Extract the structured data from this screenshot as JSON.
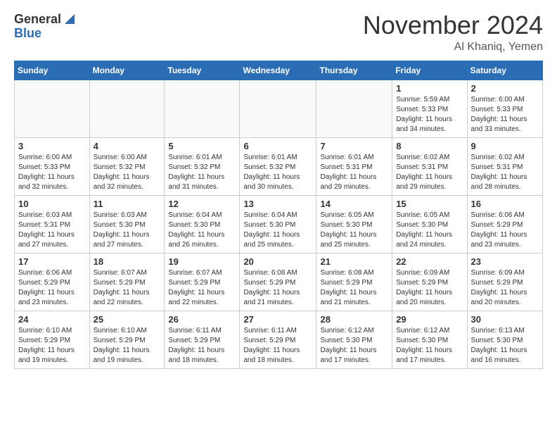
{
  "header": {
    "logo_general": "General",
    "logo_blue": "Blue",
    "title": "November 2024",
    "location": "Al Khaniq, Yemen"
  },
  "weekdays": [
    "Sunday",
    "Monday",
    "Tuesday",
    "Wednesday",
    "Thursday",
    "Friday",
    "Saturday"
  ],
  "weeks": [
    [
      {
        "day": "",
        "info": ""
      },
      {
        "day": "",
        "info": ""
      },
      {
        "day": "",
        "info": ""
      },
      {
        "day": "",
        "info": ""
      },
      {
        "day": "",
        "info": ""
      },
      {
        "day": "1",
        "info": "Sunrise: 5:59 AM\nSunset: 5:33 PM\nDaylight: 11 hours and 34 minutes."
      },
      {
        "day": "2",
        "info": "Sunrise: 6:00 AM\nSunset: 5:33 PM\nDaylight: 11 hours and 33 minutes."
      }
    ],
    [
      {
        "day": "3",
        "info": "Sunrise: 6:00 AM\nSunset: 5:33 PM\nDaylight: 11 hours and 32 minutes."
      },
      {
        "day": "4",
        "info": "Sunrise: 6:00 AM\nSunset: 5:32 PM\nDaylight: 11 hours and 32 minutes."
      },
      {
        "day": "5",
        "info": "Sunrise: 6:01 AM\nSunset: 5:32 PM\nDaylight: 11 hours and 31 minutes."
      },
      {
        "day": "6",
        "info": "Sunrise: 6:01 AM\nSunset: 5:32 PM\nDaylight: 11 hours and 30 minutes."
      },
      {
        "day": "7",
        "info": "Sunrise: 6:01 AM\nSunset: 5:31 PM\nDaylight: 11 hours and 29 minutes."
      },
      {
        "day": "8",
        "info": "Sunrise: 6:02 AM\nSunset: 5:31 PM\nDaylight: 11 hours and 29 minutes."
      },
      {
        "day": "9",
        "info": "Sunrise: 6:02 AM\nSunset: 5:31 PM\nDaylight: 11 hours and 28 minutes."
      }
    ],
    [
      {
        "day": "10",
        "info": "Sunrise: 6:03 AM\nSunset: 5:31 PM\nDaylight: 11 hours and 27 minutes."
      },
      {
        "day": "11",
        "info": "Sunrise: 6:03 AM\nSunset: 5:30 PM\nDaylight: 11 hours and 27 minutes."
      },
      {
        "day": "12",
        "info": "Sunrise: 6:04 AM\nSunset: 5:30 PM\nDaylight: 11 hours and 26 minutes."
      },
      {
        "day": "13",
        "info": "Sunrise: 6:04 AM\nSunset: 5:30 PM\nDaylight: 11 hours and 25 minutes."
      },
      {
        "day": "14",
        "info": "Sunrise: 6:05 AM\nSunset: 5:30 PM\nDaylight: 11 hours and 25 minutes."
      },
      {
        "day": "15",
        "info": "Sunrise: 6:05 AM\nSunset: 5:30 PM\nDaylight: 11 hours and 24 minutes."
      },
      {
        "day": "16",
        "info": "Sunrise: 6:06 AM\nSunset: 5:29 PM\nDaylight: 11 hours and 23 minutes."
      }
    ],
    [
      {
        "day": "17",
        "info": "Sunrise: 6:06 AM\nSunset: 5:29 PM\nDaylight: 11 hours and 23 minutes."
      },
      {
        "day": "18",
        "info": "Sunrise: 6:07 AM\nSunset: 5:29 PM\nDaylight: 11 hours and 22 minutes."
      },
      {
        "day": "19",
        "info": "Sunrise: 6:07 AM\nSunset: 5:29 PM\nDaylight: 11 hours and 22 minutes."
      },
      {
        "day": "20",
        "info": "Sunrise: 6:08 AM\nSunset: 5:29 PM\nDaylight: 11 hours and 21 minutes."
      },
      {
        "day": "21",
        "info": "Sunrise: 6:08 AM\nSunset: 5:29 PM\nDaylight: 11 hours and 21 minutes."
      },
      {
        "day": "22",
        "info": "Sunrise: 6:09 AM\nSunset: 5:29 PM\nDaylight: 11 hours and 20 minutes."
      },
      {
        "day": "23",
        "info": "Sunrise: 6:09 AM\nSunset: 5:29 PM\nDaylight: 11 hours and 20 minutes."
      }
    ],
    [
      {
        "day": "24",
        "info": "Sunrise: 6:10 AM\nSunset: 5:29 PM\nDaylight: 11 hours and 19 minutes."
      },
      {
        "day": "25",
        "info": "Sunrise: 6:10 AM\nSunset: 5:29 PM\nDaylight: 11 hours and 19 minutes."
      },
      {
        "day": "26",
        "info": "Sunrise: 6:11 AM\nSunset: 5:29 PM\nDaylight: 11 hours and 18 minutes."
      },
      {
        "day": "27",
        "info": "Sunrise: 6:11 AM\nSunset: 5:29 PM\nDaylight: 11 hours and 18 minutes."
      },
      {
        "day": "28",
        "info": "Sunrise: 6:12 AM\nSunset: 5:30 PM\nDaylight: 11 hours and 17 minutes."
      },
      {
        "day": "29",
        "info": "Sunrise: 6:12 AM\nSunset: 5:30 PM\nDaylight: 11 hours and 17 minutes."
      },
      {
        "day": "30",
        "info": "Sunrise: 6:13 AM\nSunset: 5:30 PM\nDaylight: 11 hours and 16 minutes."
      }
    ]
  ]
}
